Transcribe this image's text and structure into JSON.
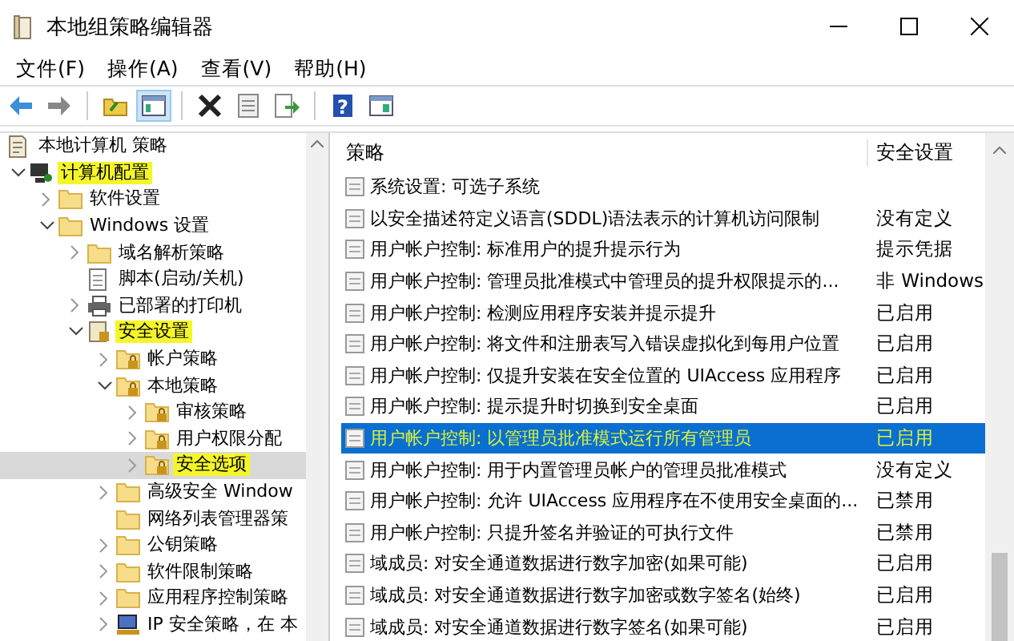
{
  "window": {
    "title": "本地组策略编辑器"
  },
  "menu": [
    "文件(F)",
    "操作(A)",
    "查看(V)",
    "帮助(H)"
  ],
  "toolbar": [
    [
      {
        "kind": "back",
        "pressed": false
      },
      {
        "kind": "forward",
        "pressed": false
      }
    ],
    [
      {
        "kind": "up",
        "pressed": false
      },
      {
        "kind": "tree",
        "pressed": true
      }
    ],
    [
      {
        "kind": "delete",
        "pressed": false
      },
      {
        "kind": "properties",
        "pressed": false
      },
      {
        "kind": "export",
        "pressed": false
      }
    ],
    [
      {
        "kind": "help",
        "pressed": false,
        "symbol": "?"
      },
      {
        "kind": "pane",
        "pressed": false
      }
    ]
  ],
  "tree": [
    {
      "label": "本地计算机 策略",
      "kind": "doc",
      "selected": false,
      "highlighted": false,
      "children": [
        {
          "label": "计算机配置",
          "kind": "computer",
          "expanded": true,
          "selected": false,
          "highlighted": true,
          "children": [
            {
              "label": "软件设置",
              "kind": "folder",
              "expanded": false,
              "selected": false,
              "highlighted": false
            },
            {
              "label": "Windows 设置",
              "kind": "folder",
              "expanded": true,
              "selected": false,
              "highlighted": false,
              "children": [
                {
                  "label": "域名解析策略",
                  "kind": "folder",
                  "expanded": false,
                  "selected": false,
                  "highlighted": false
                },
                {
                  "label": "脚本(启动/关机)",
                  "kind": "script",
                  "selected": false,
                  "highlighted": false
                },
                {
                  "label": "已部署的打印机",
                  "kind": "printer",
                  "expanded": false,
                  "selected": false,
                  "highlighted": false
                },
                {
                  "label": "安全设置",
                  "kind": "security",
                  "expanded": true,
                  "selected": false,
                  "highlighted": true,
                  "children": [
                    {
                      "label": "帐户策略",
                      "kind": "lockfolder",
                      "expanded": false,
                      "selected": false,
                      "highlighted": false
                    },
                    {
                      "label": "本地策略",
                      "kind": "lockfolder",
                      "expanded": true,
                      "selected": false,
                      "highlighted": false,
                      "children": [
                        {
                          "label": "审核策略",
                          "kind": "lockfolder",
                          "expanded": false,
                          "selected": false,
                          "highlighted": false
                        },
                        {
                          "label": "用户权限分配",
                          "kind": "lockfolder",
                          "expanded": false,
                          "selected": false,
                          "highlighted": false
                        },
                        {
                          "label": "安全选项",
                          "kind": "lockfolder",
                          "expanded": false,
                          "selected": true,
                          "highlighted": true
                        }
                      ]
                    },
                    {
                      "label": "高级安全 Window",
                      "kind": "folder",
                      "expanded": false,
                      "selected": false,
                      "highlighted": false
                    },
                    {
                      "label": "网络列表管理器策",
                      "kind": "folder",
                      "selected": false,
                      "highlighted": false
                    },
                    {
                      "label": "公钥策略",
                      "kind": "folder",
                      "expanded": false,
                      "selected": false,
                      "highlighted": false
                    },
                    {
                      "label": "软件限制策略",
                      "kind": "folder",
                      "expanded": false,
                      "selected": false,
                      "highlighted": false
                    },
                    {
                      "label": "应用程序控制策略",
                      "kind": "folder",
                      "expanded": false,
                      "selected": false,
                      "highlighted": false
                    },
                    {
                      "label": "IP 安全策略，在 本",
                      "kind": "ipsec",
                      "expanded": false,
                      "selected": false,
                      "highlighted": false
                    }
                  ]
                }
              ]
            }
          ]
        }
      ]
    }
  ],
  "list": {
    "columns": [
      "策略",
      "安全设置"
    ],
    "rows": [
      {
        "policy": "系统设置: 可选子系统",
        "setting": "",
        "selected": false,
        "highlighted": false
      },
      {
        "policy": "以安全描述符定义语言(SDDL)语法表示的计算机访问限制",
        "setting": "没有定义",
        "selected": false,
        "highlighted": false
      },
      {
        "policy": "用户帐户控制: 标准用户的提升提示行为",
        "setting": "提示凭据",
        "selected": false,
        "highlighted": false
      },
      {
        "policy": "用户帐户控制: 管理员批准模式中管理员的提升权限提示的...",
        "setting": "非 Windows",
        "selected": false,
        "highlighted": false
      },
      {
        "policy": "用户帐户控制: 检测应用程序安装并提示提升",
        "setting": "已启用",
        "selected": false,
        "highlighted": false
      },
      {
        "policy": "用户帐户控制: 将文件和注册表写入错误虚拟化到每用户位置",
        "setting": "已启用",
        "selected": false,
        "highlighted": false
      },
      {
        "policy": "用户帐户控制: 仅提升安装在安全位置的 UIAccess 应用程序",
        "setting": "已启用",
        "selected": false,
        "highlighted": false
      },
      {
        "policy": "用户帐户控制: 提示提升时切换到安全桌面",
        "setting": "已启用",
        "selected": false,
        "highlighted": false
      },
      {
        "policy": "用户帐户控制: 以管理员批准模式运行所有管理员",
        "setting": "已启用",
        "selected": true,
        "highlighted": true
      },
      {
        "policy": "用户帐户控制: 用于内置管理员帐户的管理员批准模式",
        "setting": "没有定义",
        "selected": false,
        "highlighted": false
      },
      {
        "policy": "用户帐户控制: 允许 UIAccess 应用程序在不使用安全桌面的...",
        "setting": "已禁用",
        "selected": false,
        "highlighted": false
      },
      {
        "policy": "用户帐户控制: 只提升签名并验证的可执行文件",
        "setting": "已禁用",
        "selected": false,
        "highlighted": false
      },
      {
        "policy": "域成员: 对安全通道数据进行数字加密(如果可能)",
        "setting": "已启用",
        "selected": false,
        "highlighted": false
      },
      {
        "policy": "域成员: 对安全通道数据进行数字加密或数字签名(始终)",
        "setting": "已启用",
        "selected": false,
        "highlighted": false
      },
      {
        "policy": "域成员: 对安全通道数据进行数字签名(如果可能)",
        "setting": "已启用",
        "selected": false,
        "highlighted": false
      }
    ]
  }
}
